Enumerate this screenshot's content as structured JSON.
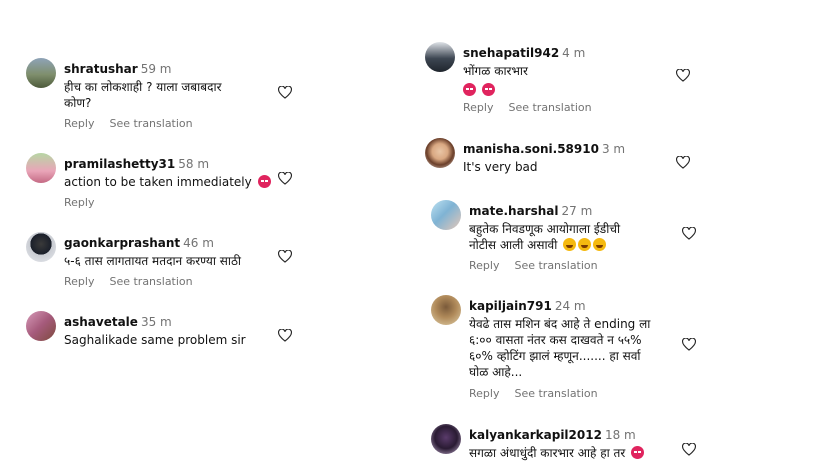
{
  "actions": {
    "reply": "Reply",
    "see_translation": "See translation"
  },
  "colors": {
    "secondary_text": "#737373",
    "angry_emoji": "#e0245e",
    "laugh_emoji": "#f5b90f"
  },
  "comments_left": [
    {
      "username": "shratushar",
      "time": "59 m",
      "lines": [
        "हीच का लोकशाही ? याला जबाबदार",
        "कोण?"
      ]
    },
    {
      "username": "pramilashetty31",
      "time": "58 m",
      "lines": [
        "action to be taken immediately"
      ]
    },
    {
      "username": "gaonkarprashant",
      "time": "46 m",
      "lines": [
        "५-६ तास लागतायत मतदान करण्या साठी"
      ]
    },
    {
      "username": "ashavetale",
      "time": "35 m",
      "lines": [
        "Saghalikade same problem sir"
      ]
    }
  ],
  "comments_right": [
    {
      "username": "snehapatil942",
      "time": "4 m",
      "lines": [
        "भोंगळ कारभार"
      ]
    },
    {
      "username": "manisha.soni.58910",
      "time": "3 m",
      "lines": [
        "It's very bad"
      ]
    },
    {
      "username": "mate.harshal",
      "time": "27 m",
      "lines": [
        "बहुतेक निवडणूक आयोगाला ईडीची",
        "नोटीस आली असावी"
      ]
    },
    {
      "username": "kapiljain791",
      "time": "24 m",
      "lines": [
        "येवढे तास मशिन बंद आहे ते ending ला",
        "६:०० वासता नंतर कस दाखवते न ५५%",
        "६०% व्होटिंग झालं म्हणून....... हा सर्वा",
        "घोळ आहे..."
      ]
    },
    {
      "username": "kalyankarkapil2012",
      "time": "18 m",
      "lines": [
        "सगळा अंधाधुंदी कारभार आहे हा तर"
      ]
    }
  ]
}
